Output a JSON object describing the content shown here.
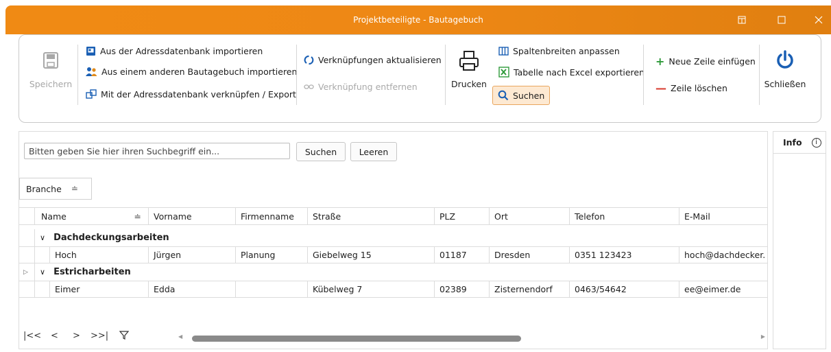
{
  "window": {
    "title": "Projektbeteiligte - Bautagebuch"
  },
  "ribbon": {
    "save": "Speichern",
    "import_db": "Aus der Adressdatenbank importieren",
    "import_other": "Aus einem anderen Bautagebuch importieren",
    "link_export": "Mit der Adressdatenbank verknüpfen / Export",
    "refresh_links": "Verknüpfungen aktualisieren",
    "remove_link": "Verknüpfung entfernen",
    "print": "Drucken",
    "fit_columns": "Spaltenbreiten anpassen",
    "export_excel": "Tabelle nach Excel exportieren",
    "search": "Suchen",
    "insert_row": "Neue Zeile einfügen",
    "delete_row": "Zeile löschen",
    "close": "Schließen"
  },
  "colors": {
    "accent": "#ef8813",
    "green": "#2e9a3a",
    "red": "#d83a2e",
    "blue": "#1a5fb4"
  },
  "search": {
    "placeholder": "Bitten geben Sie hier ihren Suchbegriff ein...",
    "button": "Suchen",
    "clear": "Leeren"
  },
  "group_by": {
    "label": "Branche"
  },
  "table": {
    "columns": [
      "Name",
      "Vorname",
      "Firmenname",
      "Straße",
      "PLZ",
      "Ort",
      "Telefon",
      "E-Mail"
    ],
    "groups": [
      {
        "label": "Dachdeckungsarbeiten",
        "rows": [
          [
            "Hoch",
            "Jürgen",
            "Planung",
            "Giebelweg 15",
            "01187",
            "Dresden",
            "0351 123423",
            "hoch@dachdecker."
          ]
        ]
      },
      {
        "label": "Estricharbeiten",
        "rows": [
          [
            "Eimer",
            "Edda",
            "",
            "Kübelweg 7",
            "02389",
            "Zisternendorf",
            "0463/54642",
            "ee@eimer.de"
          ]
        ]
      }
    ]
  },
  "info": {
    "label": "Info"
  }
}
